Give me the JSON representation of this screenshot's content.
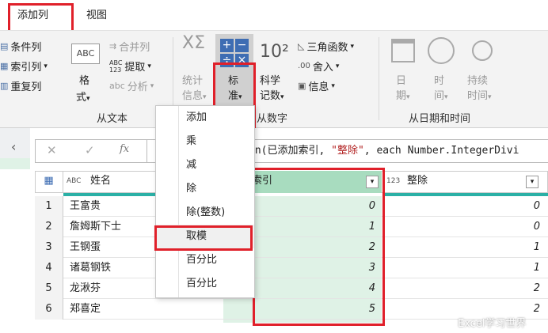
{
  "tabs": {
    "add_column": "添加列",
    "view": "视图"
  },
  "ribbon": {
    "from_text": {
      "conditional_column": "条件列",
      "index_column": "索引列",
      "duplicate_column": "重复列",
      "format_1": "格",
      "format_2": "式",
      "merge_columns": "合并列",
      "extract": "提取",
      "parse": "分析",
      "label": "从文本"
    },
    "from_number": {
      "statistics_1": "统计",
      "statistics_2": "信息",
      "standard_1": "标",
      "standard_2": "准",
      "scientific_1": "科学",
      "scientific_2": "记数",
      "trigonometry": "三角函数",
      "rounding": "舍入",
      "information": "信息",
      "label": "从数字"
    },
    "from_datetime": {
      "date_1": "日",
      "date_2": "期",
      "time_1": "时",
      "time_2": "间",
      "duration_1": "持续",
      "duration_2": "时间",
      "label": "从日期和时间"
    }
  },
  "formula": {
    "fx": "fx",
    "text_prefix": "mn(已添加索引, ",
    "text_string": "\"整除\"",
    "text_suffix": ", each Number.IntegerDivi"
  },
  "table": {
    "col_name_type": "ABC",
    "col_name": "姓名",
    "col_index": "索引",
    "col_div_type": "123",
    "col_div": "整除",
    "rows": [
      {
        "n": "1",
        "name": "王富贵",
        "index": "0",
        "div": "0"
      },
      {
        "n": "2",
        "name": "詹姆斯下士",
        "index": "1",
        "div": "0"
      },
      {
        "n": "3",
        "name": "王钢蛋",
        "index": "2",
        "div": "1"
      },
      {
        "n": "4",
        "name": "诸葛钢铁",
        "index": "3",
        "div": "1"
      },
      {
        "n": "5",
        "name": "龙湫芬",
        "index": "4",
        "div": "2"
      },
      {
        "n": "6",
        "name": "郑喜定",
        "index": "5",
        "div": "2"
      }
    ]
  },
  "menu": {
    "items": [
      "添加",
      "乘",
      "减",
      "除",
      "除(整数)",
      "取模",
      "百分比",
      "百分比"
    ]
  },
  "watermark": "Excel学习世界",
  "colors": {
    "highlight_red": "#e0202a",
    "column_green": "#dff2e6",
    "header_green": "#a8dcbf",
    "ribbon_bg": "#f3f3f3"
  }
}
